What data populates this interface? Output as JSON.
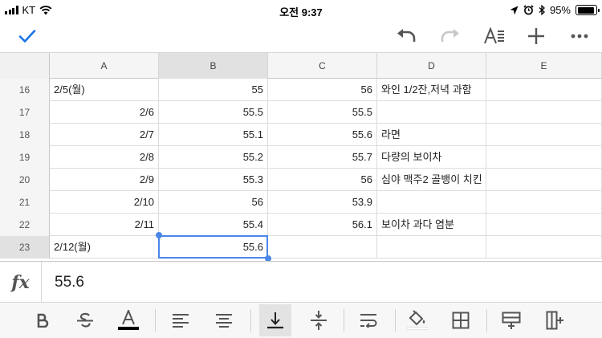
{
  "status_bar": {
    "carrier": "KT",
    "time": "오전 9:37",
    "battery_percent": "95%",
    "battery_level": 0.95
  },
  "toolbar": {
    "confirm_icon": "checkmark-icon",
    "undo_icon": "undo-icon",
    "redo_icon": "redo-icon",
    "text_format_icon": "text-format-icon",
    "insert_icon": "plus-icon",
    "more_icon": "more-icon",
    "accent_color": "#1a73e8"
  },
  "grid": {
    "columns": [
      "A",
      "B",
      "C",
      "D",
      "E"
    ],
    "selected_column": "B",
    "selected_row": "23",
    "rows": [
      {
        "num": "16",
        "a": "2/5(월)",
        "b": "55",
        "c": "56",
        "d": "와인 1/2잔,저녁 과함",
        "e": ""
      },
      {
        "num": "17",
        "a": "2/6",
        "b": "55.5",
        "c": "55.5",
        "d": "",
        "e": ""
      },
      {
        "num": "18",
        "a": "2/7",
        "b": "55.1",
        "c": "55.6",
        "d": "라면",
        "e": ""
      },
      {
        "num": "19",
        "a": "2/8",
        "b": "55.2",
        "c": "55.7",
        "d": "다량의 보이차",
        "e": ""
      },
      {
        "num": "20",
        "a": "2/9",
        "b": "55.3",
        "c": "56",
        "d": "심야 맥주2 골뱅이 치킨",
        "e": ""
      },
      {
        "num": "21",
        "a": "2/10",
        "b": "56",
        "c": "53.9",
        "d": "",
        "e": ""
      },
      {
        "num": "22",
        "a": "2/11",
        "b": "55.4",
        "c": "56.1",
        "d": "보이차 과다   염분",
        "e": ""
      },
      {
        "num": "23",
        "a": "2/12(월)",
        "b": "55.6",
        "c": "",
        "d": "",
        "e": ""
      }
    ],
    "selection_color": "#4a86e8"
  },
  "formula_bar": {
    "fx_label": "fx",
    "value": "55.6"
  },
  "format_bar": {
    "buttons": [
      "bold-icon",
      "strikethrough-icon",
      "text-color-icon",
      "align-left-icon",
      "align-center-icon",
      "valign-bottom-icon",
      "valign-middle-icon",
      "wrap-text-icon",
      "fill-color-icon",
      "borders-icon",
      "insert-row-icon",
      "insert-column-icon"
    ],
    "active_button": "valign-bottom-icon"
  }
}
